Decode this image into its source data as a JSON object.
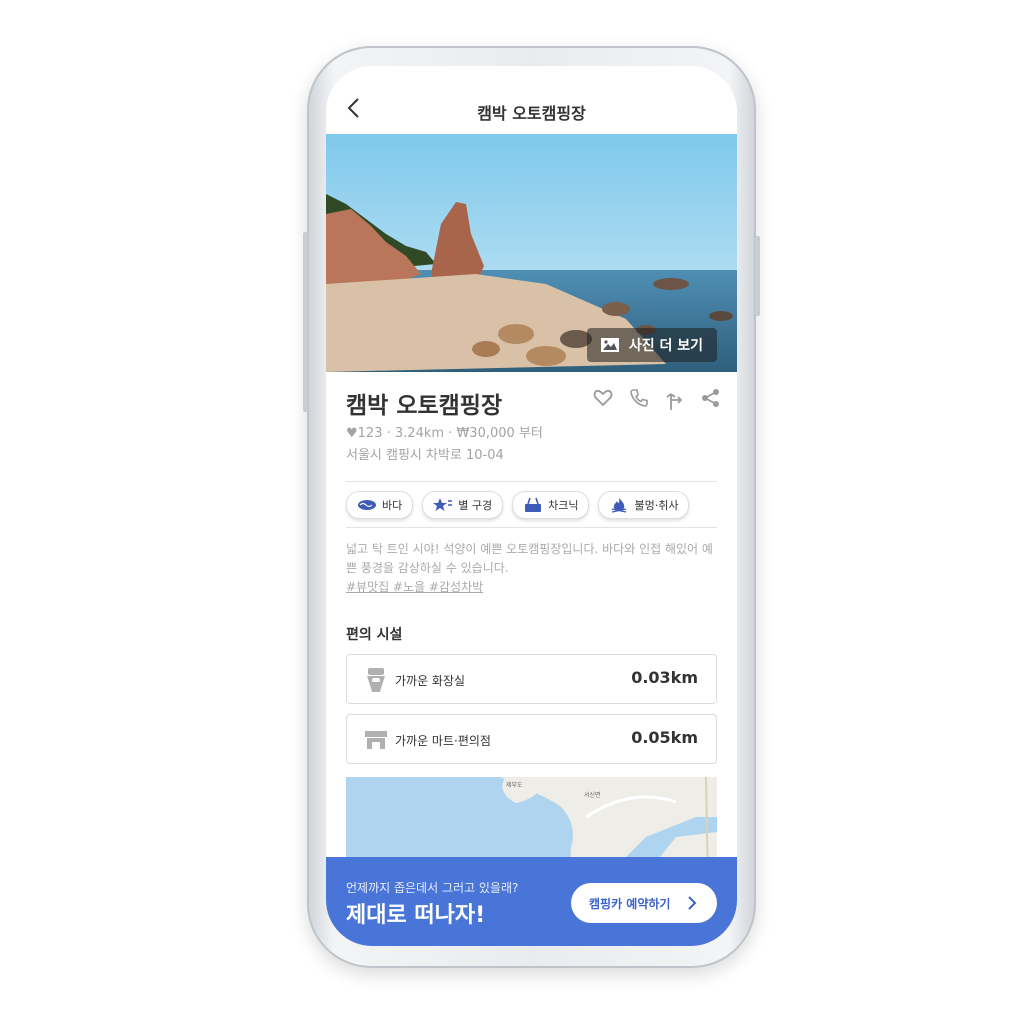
{
  "header": {
    "title": "캠박 오토캠핑장"
  },
  "photo": {
    "more_label": "사진 더 보기"
  },
  "place": {
    "name": "캠박 오토캠핑장",
    "likes": "123",
    "distance": "3.24km",
    "price": "₩30,000 부터",
    "address": "서울시 캠핑시 차박로 10-04"
  },
  "tags": [
    {
      "label": "바다",
      "icon": "sea-icon"
    },
    {
      "label": "별 구경",
      "icon": "star-icon"
    },
    {
      "label": "차크닉",
      "icon": "picnic-basket-icon"
    },
    {
      "label": "불멍·취사",
      "icon": "fire-icon"
    }
  ],
  "description": {
    "text": "넓고 탁 트인 시야! 석양이 예쁜 오토캠핑장입니다. 바다와 인접 해있어 예쁜 풍경을 감상하실 수 있습니다.",
    "hashtags": "#뷰맛집 #노을 #감성차박"
  },
  "facilities": {
    "title": "편의 시설",
    "items": [
      {
        "label": "가까운 화장실",
        "distance": "0.03km",
        "icon": "toilet-icon"
      },
      {
        "label": "가까운 마트·편의점",
        "distance": "0.05km",
        "icon": "store-icon"
      }
    ]
  },
  "map": {
    "label_1": "제부도",
    "label_2": "서신면"
  },
  "banner": {
    "subtitle": "언제까지 좁은데서 그러고 있을래?",
    "headline": "제대로 떠나자!",
    "cta_label": "캠핑카 예약하기"
  },
  "colors": {
    "accent": "#4a75d8",
    "text": "#333333",
    "muted": "#a4a4a4",
    "tag_icon": "#3f5bb8"
  }
}
